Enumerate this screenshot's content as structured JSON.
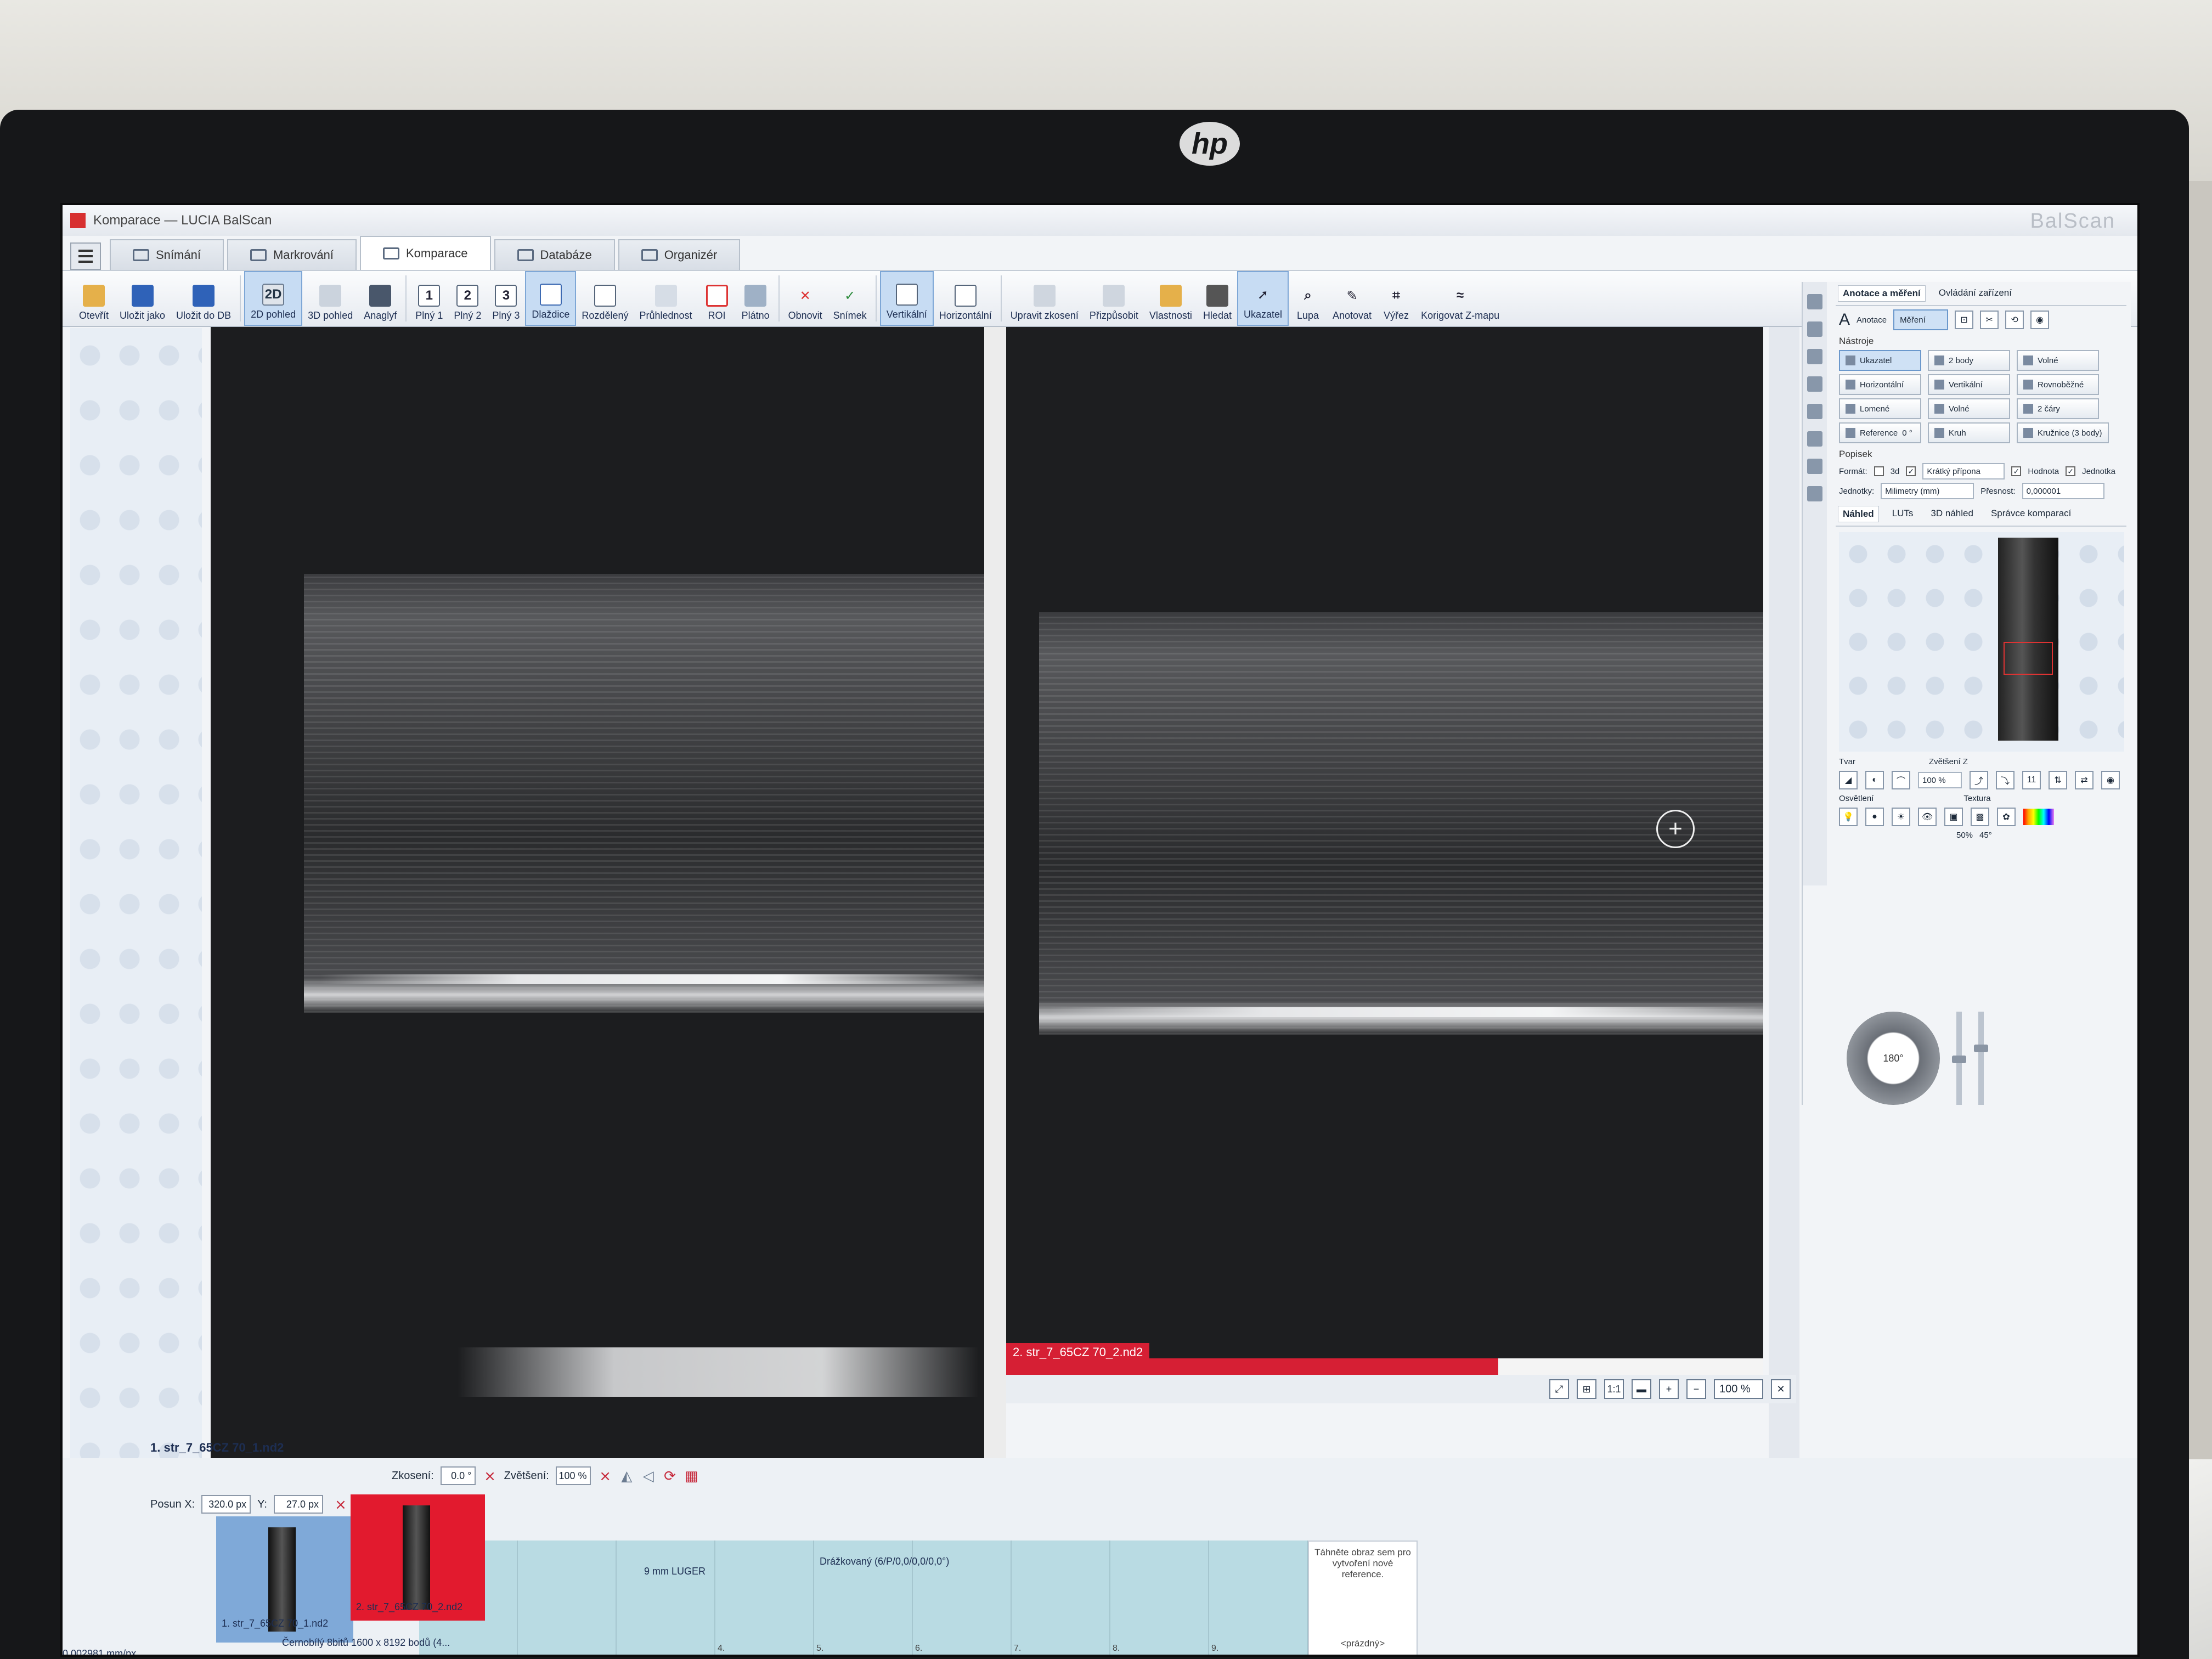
{
  "window": {
    "title": "Komparace — LUCIA BalScan",
    "brand": "BalScan"
  },
  "tabs": [
    {
      "label": "Snímání"
    },
    {
      "label": "Markrování"
    },
    {
      "label": "Komparace"
    },
    {
      "label": "Databáze"
    },
    {
      "label": "Organizér"
    }
  ],
  "toolbar": {
    "open": "Otevřít",
    "save_as": "Uložit jako",
    "save_db": "Uložit do DB",
    "view_2d": "2D pohled",
    "view_2d_icon": "2D",
    "view_3d": "3D pohled",
    "anaglyph": "Anaglyf",
    "full1": "Plný 1",
    "full2": "Plný 2",
    "full3": "Plný 3",
    "full1_icon": "1",
    "full2_icon": "2",
    "full3_icon": "3",
    "tiles": "Dlaždice",
    "split": "Rozdělený",
    "transparency": "Průhlednost",
    "roi": "ROI",
    "canvas": "Plátno",
    "refresh": "Obnovit",
    "snapshot": "Snímek",
    "vertical": "Vertikální",
    "horizontal": "Horizontální",
    "edit_skew": "Upravit zkosení",
    "fit": "Přizpůsobit",
    "properties": "Vlastnosti",
    "search": "Hledat",
    "pointer": "Ukazatel",
    "magnifier": "Lupa",
    "annotate": "Anotovat",
    "crop": "Výřez",
    "correct_z": "Korigovat Z-mapu"
  },
  "right_panel": {
    "tabs": [
      "Anotace a měření",
      "Ovládání zařízení"
    ],
    "annotation_label": "Anotace",
    "measure_label": "Měření",
    "tools_title": "Nástroje",
    "tools": [
      "Ukazatel",
      "2 body",
      "Volné",
      "Horizontální",
      "Vertikální",
      "Rovnoběžné",
      "Lomené",
      "Volné",
      "2 čáry",
      "Reference",
      "Kruh",
      "Kružnice (3 body)"
    ],
    "reference_angle": "0 °",
    "caption_title": "Popisek",
    "format_label": "Formát:",
    "format_checkbox": "3d",
    "format_value": "Krátký přípona",
    "value_label": "Hodnota",
    "unit_label": "Jednotka",
    "units_label": "Jednotky:",
    "units_value": "Milimetry (mm)",
    "precision_label": "Přesnost:",
    "precision_value": "0,000001",
    "preview_tabs": [
      "Náhled",
      "LUTs",
      "3D náhled",
      "Správce komparací"
    ],
    "shape_label": "Tvar",
    "zoom_z_label": "Zvětšení Z",
    "zoom_z_value": "100 %",
    "texture_label": "Textura",
    "lighting_label": "Osvětlení",
    "dial_value": "180°",
    "slider1_label": "50%",
    "slider2_label": "45°"
  },
  "viewer": {
    "left_caption": "1. str_7_65CZ 70_1.nd2",
    "right_caption": "2. str_7_65CZ 70_2.nd2",
    "zoom": "100 %"
  },
  "bottom": {
    "pos_x_label": "Posun X:",
    "pos_x": "320.0 px",
    "pos_y_label": "Y:",
    "pos_y": "27.0 px",
    "skew_label": "Zkosení:",
    "skew": "0.0 °",
    "zoom_label": "Zvětšení:",
    "zoom": "100 %",
    "slots": [
      "",
      "",
      "",
      "4.",
      "5.",
      "6.",
      "7.",
      "8.",
      "9."
    ],
    "drop_hint": "Táhněte obraz sem pro vytvoření nové reference.",
    "empty": "<prázdný>",
    "thumb1": "1. str_7_65CZ 70_1.nd2",
    "thumb2": "2. str_7_65CZ 70_2.nd2",
    "caliber": "9 mm LUGER",
    "rifling": "Drážkovaný (6/P/0,0/0,0/0,0°)",
    "status": "Černobílý 8bitů 1600 x 8192 bodů (4...",
    "scale": "0.002981 mm/px"
  }
}
